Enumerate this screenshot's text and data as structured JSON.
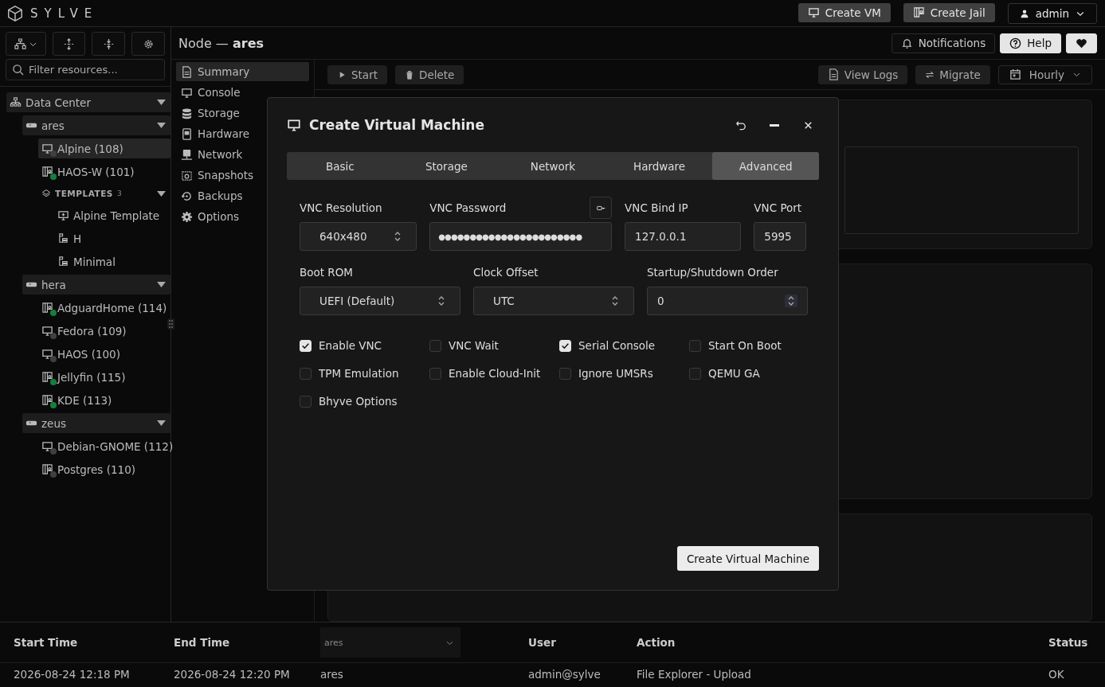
{
  "app": {
    "name": "SYLVE"
  },
  "header_buttons": [
    {
      "label": "Create VM",
      "kind": "vm"
    },
    {
      "label": "Create Jail",
      "kind": "jail"
    }
  ],
  "user_menu": {
    "label": "admin"
  },
  "sidebar": {
    "search": {
      "placeholder": "Filter resources..."
    },
    "tree": [
      {
        "label": "Data Center",
        "kind": "datacenter",
        "expanded": true,
        "children": [
          {
            "label": "ares",
            "kind": "node",
            "expanded": true,
            "children": [
              {
                "label": "Alpine (108)",
                "kind": "vm",
                "color": "#404040",
                "selected": true
              },
              {
                "label": "HAOS-W (101)",
                "kind": "jail",
                "color": "#15803d",
                "selected": false
              },
              {
                "label": "TEMPLATES",
                "count": "3",
                "kind": "templates",
                "expanded": true,
                "children": [
                  {
                    "label": "Alpine Template",
                    "kind": "vm-template",
                    "selected": false
                  },
                  {
                    "label": "H",
                    "kind": "jail-template",
                    "selected": false
                  },
                  {
                    "label": "Minimal",
                    "kind": "jail-template",
                    "selected": false
                  }
                ]
              }
            ]
          },
          {
            "label": "hera",
            "kind": "node",
            "expanded": true,
            "children": [
              {
                "label": "AdguardHome (114)",
                "kind": "jail",
                "color": "#15803d",
                "selected": false
              },
              {
                "label": "Fedora (109)",
                "kind": "vm",
                "color": "#404040",
                "selected": false
              },
              {
                "label": "HAOS (100)",
                "kind": "vm",
                "color": "#404040",
                "selected": false
              },
              {
                "label": "Jellyfin (115)",
                "kind": "jail",
                "color": "#15803d",
                "selected": false
              },
              {
                "label": "KDE (113)",
                "kind": "jail",
                "color": "#15803d",
                "selected": false
              }
            ]
          },
          {
            "label": "zeus",
            "kind": "node",
            "expanded": true,
            "children": [
              {
                "label": "Debian-GNOME (112)",
                "kind": "vm",
                "color": "#404040",
                "selected": false
              },
              {
                "label": "Postgres (110)",
                "kind": "jail",
                "color": "#404040",
                "selected": false
              }
            ]
          }
        ]
      }
    ]
  },
  "page": {
    "title_prefix": "Node —",
    "title_name": "ares"
  },
  "top_actions": [
    {
      "label": "Notifications",
      "kind": "bell"
    },
    {
      "label": "Help",
      "kind": "help"
    },
    {
      "kind": "heart"
    }
  ],
  "nav": [
    {
      "label": "Summary",
      "kind": "summary",
      "selected": true
    },
    {
      "label": "Console",
      "kind": "console",
      "selected": false
    },
    {
      "label": "Storage",
      "kind": "storage",
      "selected": false
    },
    {
      "label": "Hardware",
      "kind": "hardware",
      "selected": false
    },
    {
      "label": "Network",
      "kind": "network",
      "selected": false
    },
    {
      "label": "Snapshots",
      "kind": "snapshots",
      "selected": false
    },
    {
      "label": "Backups",
      "kind": "backups",
      "selected": false
    },
    {
      "label": "Options",
      "kind": "options",
      "selected": false
    }
  ],
  "toolbar": {
    "left": [
      {
        "label": "Start",
        "kind": "play"
      },
      {
        "label": "Delete",
        "kind": "trash"
      }
    ],
    "right": [
      {
        "label": "View Logs",
        "kind": "file"
      },
      {
        "label": "Migrate",
        "kind": "arrows"
      },
      {
        "label": "Hourly",
        "kind": "calendar"
      }
    ]
  },
  "dialog": {
    "title": "Create Virtual Machine",
    "tabs": [
      {
        "label": "Basic",
        "selected": false
      },
      {
        "label": "Storage",
        "selected": false
      },
      {
        "label": "Network",
        "selected": false
      },
      {
        "label": "Hardware",
        "selected": false
      },
      {
        "label": "Advanced",
        "selected": true
      }
    ],
    "vnc_resolution": {
      "label": "VNC Resolution",
      "value": "640x480"
    },
    "vnc_password": {
      "label": "VNC Password",
      "masked": "●●●●●●●●●●●●●●●●●●●●●●●"
    },
    "vnc_bind_ip": {
      "label": "VNC Bind IP",
      "value": "127.0.0.1"
    },
    "vnc_port": {
      "label": "VNC Port",
      "value": "5995"
    },
    "boot_rom": {
      "label": "Boot ROM",
      "value": "UEFI (Default)"
    },
    "clock_offset": {
      "label": "Clock Offset",
      "value": "UTC"
    },
    "startup_order": {
      "label": "Startup/Shutdown Order",
      "value": "0"
    },
    "options": [
      {
        "label": "Enable VNC",
        "checked": true
      },
      {
        "label": "VNC Wait",
        "checked": false
      },
      {
        "label": "Serial Console",
        "checked": true
      },
      {
        "label": "Start On Boot",
        "checked": false
      },
      {
        "label": "TPM Emulation",
        "checked": false
      },
      {
        "label": "Enable Cloud-Init",
        "checked": false
      },
      {
        "label": "Ignore UMSRs",
        "checked": false
      },
      {
        "label": "QEMU GA",
        "checked": false
      },
      {
        "label": "Bhyve Options",
        "checked": false
      }
    ],
    "submit": "Create Virtual Machine"
  },
  "log_table": {
    "columns": [
      "Start Time",
      "End Time",
      "ares",
      "User",
      "Action",
      "Status"
    ],
    "rows": [
      [
        "2026-08-24 12:18 PM",
        "2026-08-24 12:20 PM",
        "ares",
        "admin@sylve",
        "File Explorer - Upload",
        "OK"
      ]
    ]
  }
}
